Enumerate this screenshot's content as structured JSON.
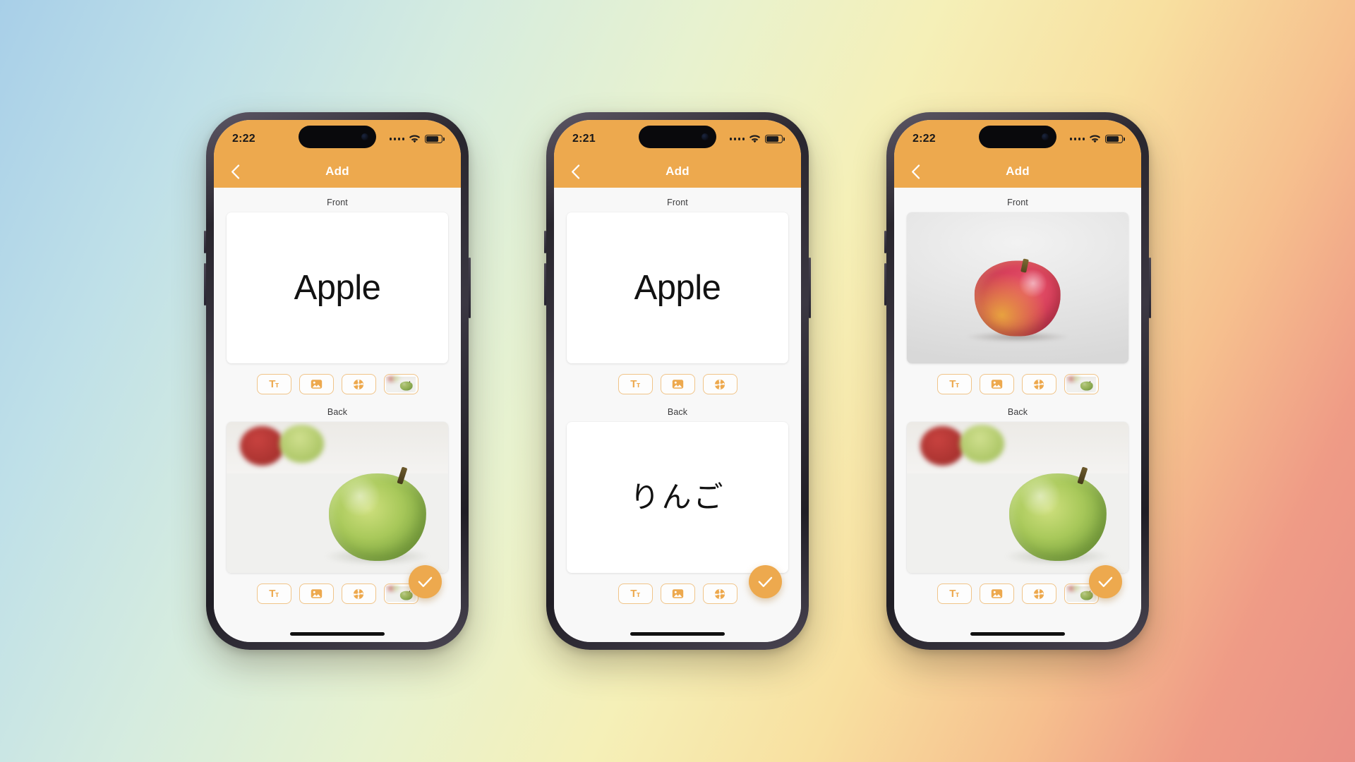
{
  "background": {
    "gradient_colors": [
      "#a8cfe8",
      "#d6ecdf",
      "#f5f0b8",
      "#f6c08e",
      "#e98f86"
    ]
  },
  "theme": {
    "accent": "#eda94e",
    "accent_border": "#f0c489",
    "card_bg": "#ffffff",
    "screen_bg": "#f8f8f8",
    "nav_title_color": "#ffffff"
  },
  "toolbar_icons": [
    {
      "name": "text-format-icon",
      "glyph": "Tт",
      "label": "Text"
    },
    {
      "name": "photo-library-icon",
      "glyph": "image",
      "label": "Photo"
    },
    {
      "name": "camera-aperture-icon",
      "glyph": "aperture",
      "label": "Camera"
    },
    {
      "name": "image-thumbnail-icon",
      "glyph": "thumbnail",
      "label": "Selected image"
    }
  ],
  "phones": [
    {
      "id": "phone-1",
      "status": {
        "time": "2:22",
        "signal_icon": "signal-dots-icon",
        "wifi_icon": "wifi-icon",
        "battery_icon": "battery-icon",
        "battery_level": "84"
      },
      "nav": {
        "back_icon": "chevron-left-icon",
        "title": "Add"
      },
      "front": {
        "label": "Front",
        "content_type": "text",
        "text": "Apple",
        "tools": [
          "text-format-icon",
          "photo-library-icon",
          "camera-aperture-icon",
          "image-thumbnail-icon"
        ]
      },
      "back": {
        "label": "Back",
        "content_type": "image",
        "image_alt": "green-apple-photo",
        "tools": [
          "text-format-icon",
          "photo-library-icon",
          "camera-aperture-icon",
          "image-thumbnail-icon"
        ]
      },
      "fab": {
        "icon": "checkmark-icon",
        "label": "Save"
      }
    },
    {
      "id": "phone-2",
      "status": {
        "time": "2:21",
        "signal_icon": "signal-dots-icon",
        "wifi_icon": "wifi-icon",
        "battery_icon": "battery-icon",
        "battery_level": "84"
      },
      "nav": {
        "back_icon": "chevron-left-icon",
        "title": "Add"
      },
      "front": {
        "label": "Front",
        "content_type": "text",
        "text": "Apple",
        "tools": [
          "text-format-icon",
          "photo-library-icon",
          "camera-aperture-icon"
        ]
      },
      "back": {
        "label": "Back",
        "content_type": "text",
        "text": "りんご",
        "tools": [
          "text-format-icon",
          "photo-library-icon",
          "camera-aperture-icon"
        ]
      },
      "fab": {
        "icon": "checkmark-icon",
        "label": "Save"
      }
    },
    {
      "id": "phone-3",
      "status": {
        "time": "2:22",
        "signal_icon": "signal-dots-icon",
        "wifi_icon": "wifi-icon",
        "battery_icon": "battery-icon",
        "battery_level": "84"
      },
      "nav": {
        "back_icon": "chevron-left-icon",
        "title": "Add"
      },
      "front": {
        "label": "Front",
        "content_type": "image",
        "image_alt": "red-apple-photo",
        "tools": [
          "text-format-icon",
          "photo-library-icon",
          "camera-aperture-icon",
          "image-thumbnail-icon"
        ]
      },
      "back": {
        "label": "Back",
        "content_type": "image",
        "image_alt": "green-apple-photo",
        "tools": [
          "text-format-icon",
          "photo-library-icon",
          "camera-aperture-icon",
          "image-thumbnail-icon"
        ]
      },
      "fab": {
        "icon": "checkmark-icon",
        "label": "Save"
      }
    }
  ]
}
